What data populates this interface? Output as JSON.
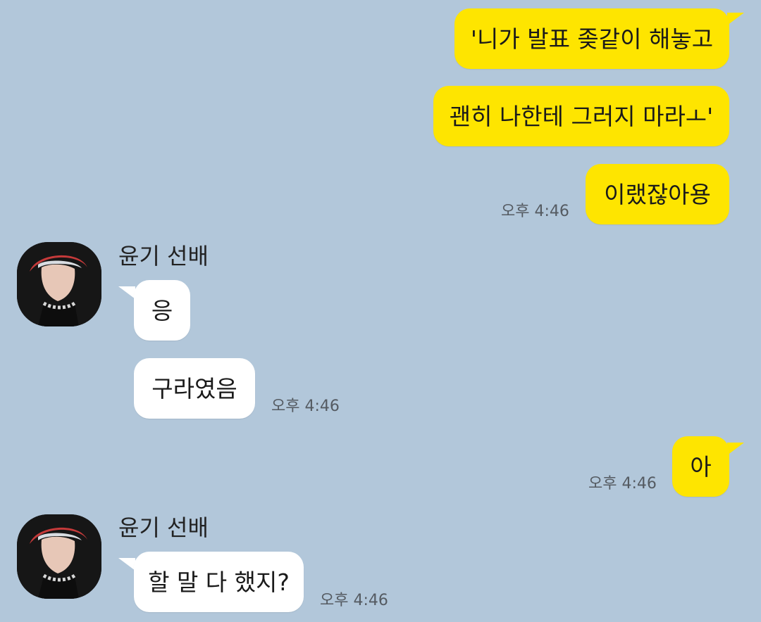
{
  "chat": {
    "messages": [
      {
        "id": "m1",
        "side": "out",
        "text": "'니가 발표 좆같이 해놓고"
      },
      {
        "id": "m2",
        "side": "out",
        "text": "괜히 나한테 그러지 마라ㅗ'"
      },
      {
        "id": "m3",
        "side": "out",
        "text": "이랬잖아용",
        "time": "오후 4:46"
      },
      {
        "id": "m4",
        "side": "in",
        "sender": "윤기 선배",
        "text": "응"
      },
      {
        "id": "m5",
        "side": "in",
        "text": "구라였음",
        "time": "오후 4:46"
      },
      {
        "id": "m6",
        "side": "out",
        "text": "아",
        "time": "오후 4:46"
      },
      {
        "id": "m7",
        "side": "in",
        "sender": "윤기 선배",
        "text": "할 말 다 했지?",
        "time": "오후 4:46"
      }
    ]
  },
  "colors": {
    "background": "#b2c7da",
    "outgoing_bubble": "#fee500",
    "incoming_bubble": "#ffffff",
    "timestamp_text": "#555b62"
  },
  "icons": {
    "avatar": "profile-photo"
  }
}
